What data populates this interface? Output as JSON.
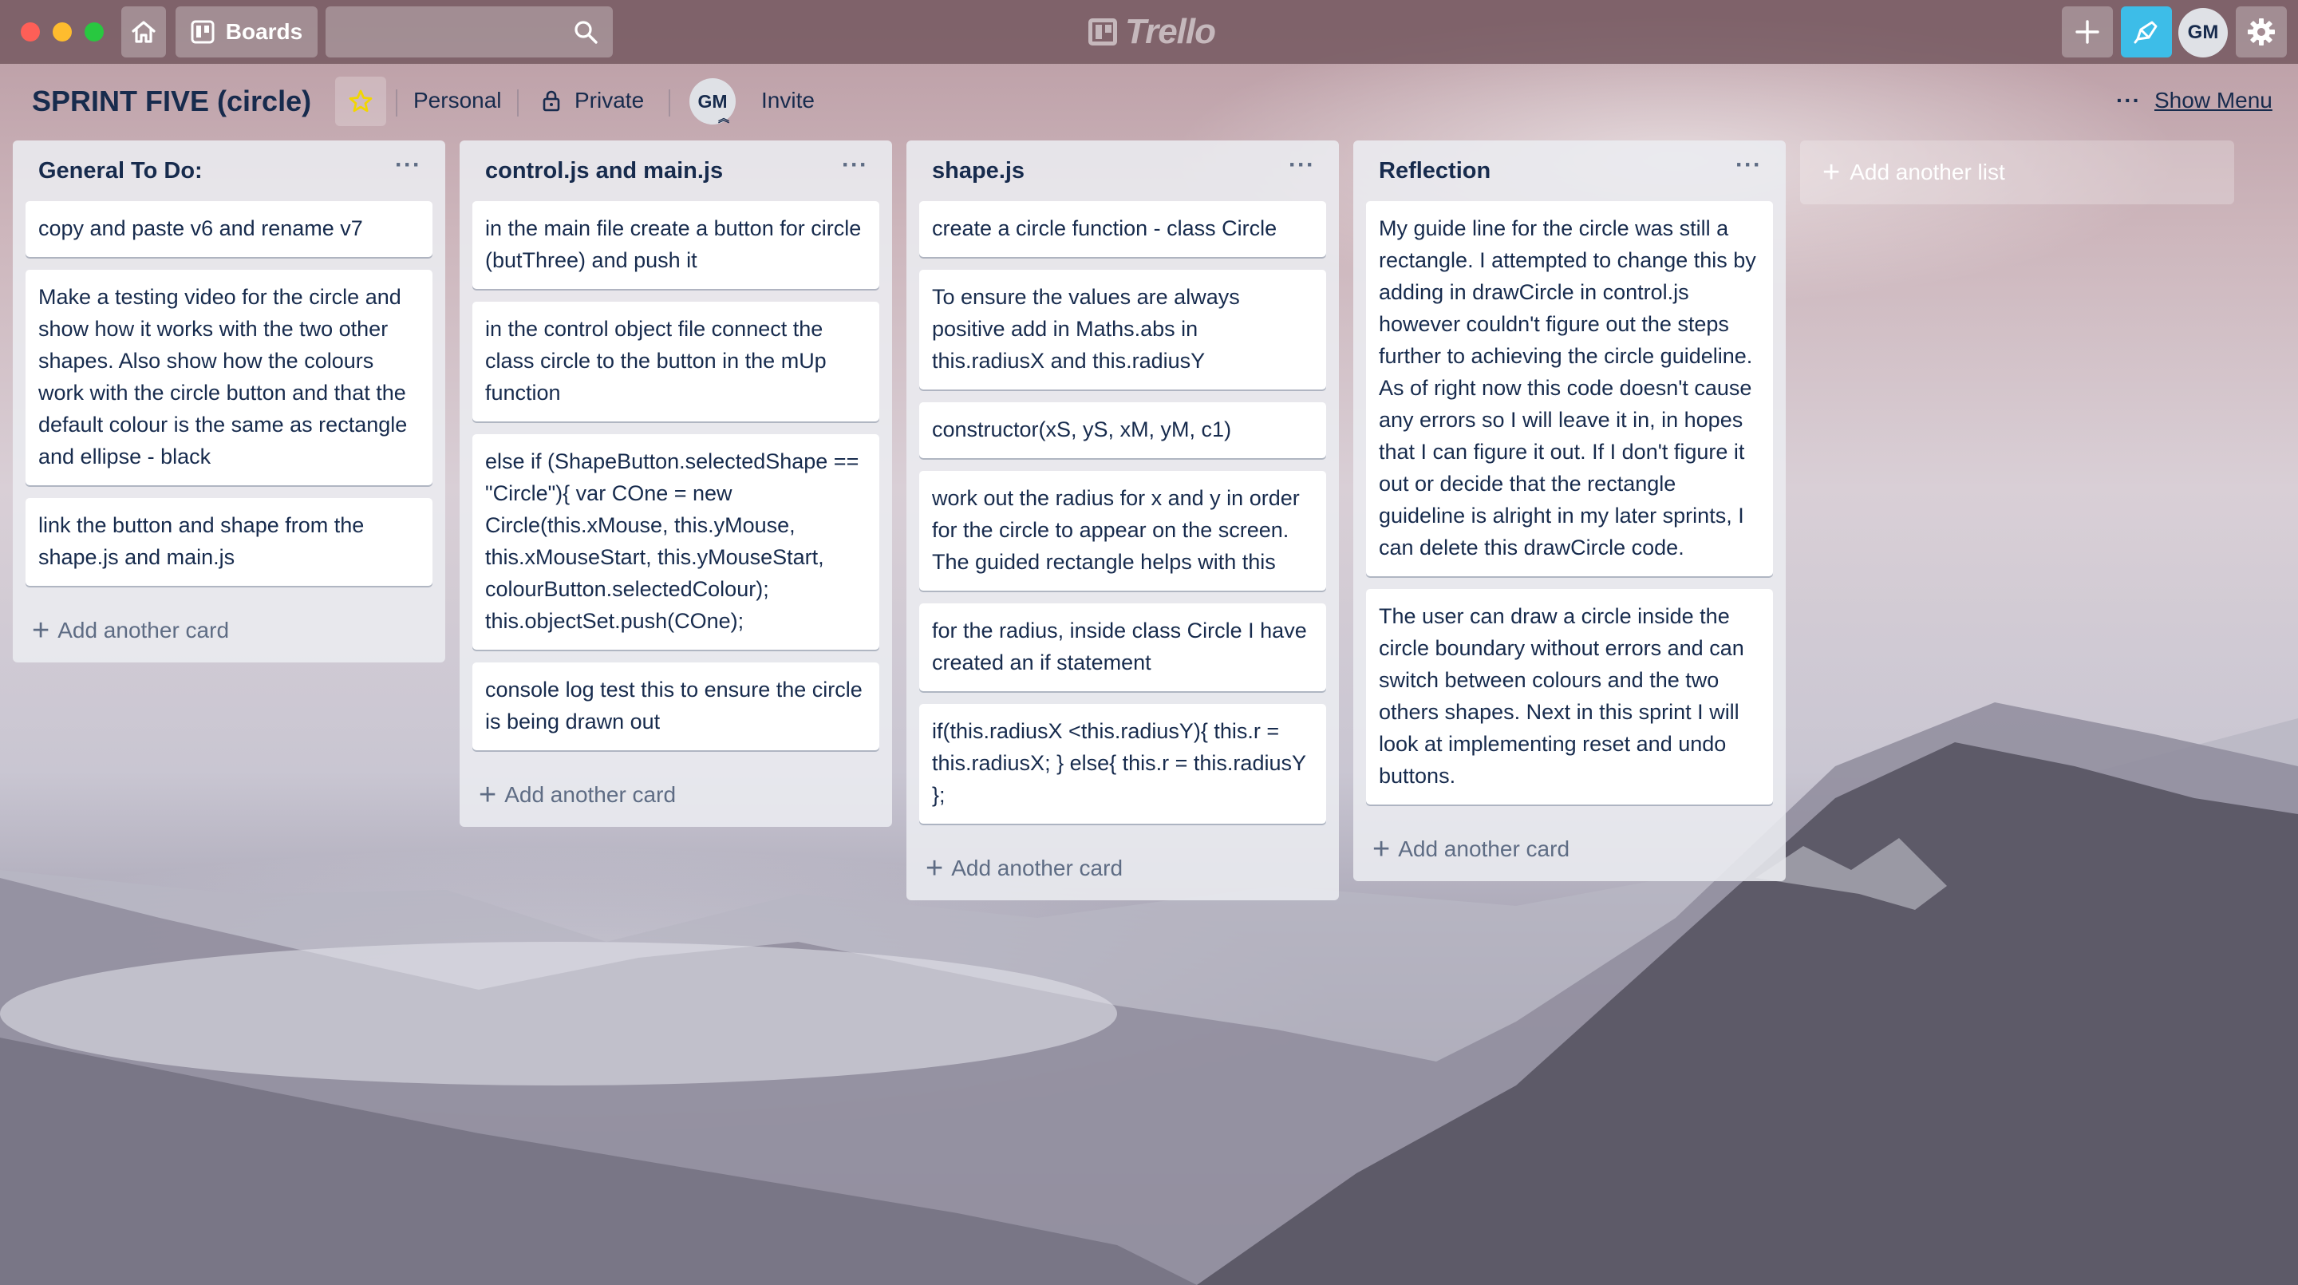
{
  "topbar": {
    "boards_label": "Boards",
    "logo_text": "Trello",
    "avatar_initials": "GM"
  },
  "board": {
    "title": "SPRINT FIVE (circle)",
    "team": "Personal",
    "visibility": "Private",
    "member_initials": "GM",
    "invite_label": "Invite",
    "show_menu_label": "Show Menu",
    "dots": "···"
  },
  "lists": [
    {
      "title": "General To Do:",
      "cards": [
        "copy and paste v6 and rename v7",
        "Make a testing video for the circle and show how it works with the two other shapes. Also show how the colours work with the circle button and that the default colour is the same as rectangle and ellipse - black",
        "link the button and shape from the shape.js and main.js"
      ],
      "add_card_label": "Add another card"
    },
    {
      "title": "control.js and main.js",
      "cards": [
        "in the main file create a button for circle (butThree) and push it",
        "in the control object file connect the class circle to the button in the mUp function",
        "else if (ShapeButton.selectedShape == \"Circle\"){ var COne = new Circle(this.xMouse, this.yMouse, this.xMouseStart, this.yMouseStart, colourButton.selectedColour); this.objectSet.push(COne);",
        "console log test this to ensure the circle is being drawn out"
      ],
      "add_card_label": "Add another card"
    },
    {
      "title": "shape.js",
      "cards": [
        "create a circle function - class Circle",
        "To ensure the values are always positive add in Maths.abs in this.radiusX and this.radiusY",
        "constructor(xS, yS, xM, yM, c1)",
        "work out the radius for x and y in order for the circle to appear on the screen. The guided rectangle helps with this",
        "for the radius, inside class Circle I have created an if statement",
        "if(this.radiusX <this.radiusY){ this.r = this.radiusX; } else{ this.r = this.radiusY };"
      ],
      "add_card_label": "Add another card"
    },
    {
      "title": "Reflection",
      "cards": [
        "My guide line for the circle was still a rectangle. I attempted to change this by adding in drawCircle in control.js however couldn't figure out the steps further to achieving the circle guideline. As of right now this code doesn't cause any errors so I will leave it in, in hopes that I can figure it out. If I don't figure it out or decide that the rectangle guideline is alright in my later sprints, I can delete this drawCircle code.",
        "The user can draw a circle inside the circle boundary without errors and can switch between colours and the two others shapes. Next in this sprint I will look at implementing reset and undo buttons."
      ],
      "add_card_label": "Add another card"
    }
  ],
  "add_list_label": "Add another list",
  "icons": {
    "home": "home-icon",
    "boards": "boards-icon",
    "search": "search-icon",
    "plus": "plus-icon",
    "notifications": "megaphone-icon",
    "settings": "gear-icon",
    "star": "star-icon",
    "lock": "lock-icon"
  },
  "colors": {
    "star": "#f2d600",
    "notify_button": "#3dbde8",
    "text": "#172b4d"
  }
}
